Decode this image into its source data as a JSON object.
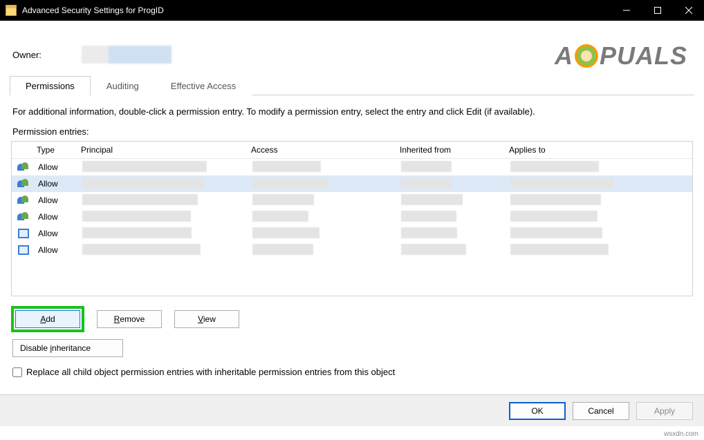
{
  "window": {
    "title": "Advanced Security Settings for ProgID"
  },
  "owner": {
    "label": "Owner:"
  },
  "watermark": {
    "part1": "A",
    "part2": "PUALS"
  },
  "tabs": [
    {
      "label": "Permissions",
      "active": true
    },
    {
      "label": "Auditing",
      "active": false
    },
    {
      "label": "Effective Access",
      "active": false
    }
  ],
  "info_text": "For additional information, double-click a permission entry. To modify a permission entry, select the entry and click Edit (if available).",
  "entries_label": "Permission entries:",
  "columns": {
    "type": "Type",
    "principal": "Principal",
    "access": "Access",
    "inherited": "Inherited from",
    "applies": "Applies to"
  },
  "entries": [
    {
      "type": "Allow",
      "icon": "people",
      "selected": false
    },
    {
      "type": "Allow",
      "icon": "people",
      "selected": true
    },
    {
      "type": "Allow",
      "icon": "people",
      "selected": false
    },
    {
      "type": "Allow",
      "icon": "people",
      "selected": false
    },
    {
      "type": "Allow",
      "icon": "rect",
      "selected": false
    },
    {
      "type": "Allow",
      "icon": "rect",
      "selected": false
    }
  ],
  "buttons": {
    "add": "Add",
    "remove": "Remove",
    "view": "View",
    "disable_inheritance": "Disable inheritance",
    "ok": "OK",
    "cancel": "Cancel",
    "apply": "Apply"
  },
  "checkbox": {
    "label": "Replace all child object permission entries with inheritable permission entries from this object",
    "checked": false
  },
  "site_credit": "wsxdn.com"
}
